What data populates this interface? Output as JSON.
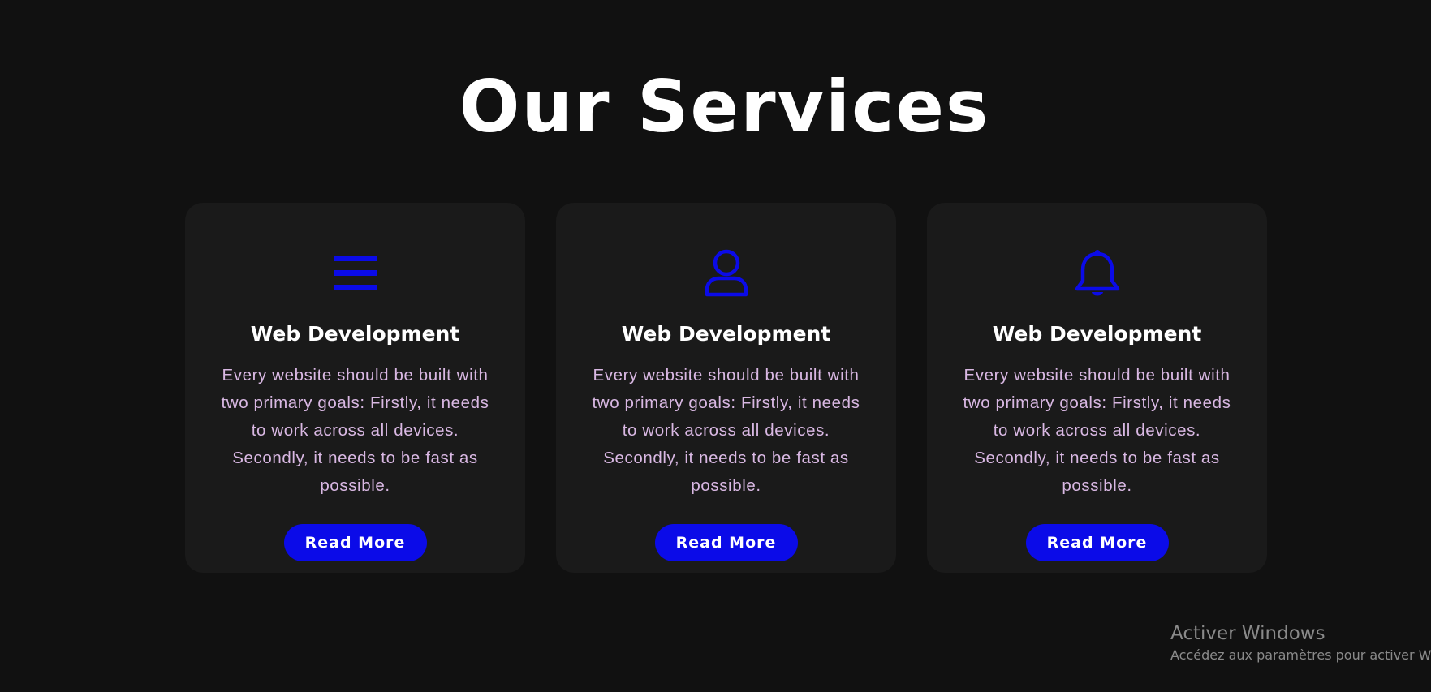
{
  "section": {
    "title": "Our Services"
  },
  "cards": [
    {
      "icon": "menu-bars-icon",
      "title": "Web Development",
      "text": "Every website should be built with two primary goals: Firstly, it needs to work across all devices. Secondly, it needs to be fast as possible.",
      "button_label": "Read More"
    },
    {
      "icon": "user-icon",
      "title": "Web Development",
      "text": "Every website should be built with two primary goals: Firstly, it needs to work across all devices. Secondly, it needs to be fast as possible.",
      "button_label": "Read More"
    },
    {
      "icon": "bell-icon",
      "title": "Web Development",
      "text": "Every website should be built with two primary goals: Firstly, it needs to work across all devices. Secondly, it needs to be fast as possible.",
      "button_label": "Read More"
    }
  ],
  "watermark": {
    "title": "Activer Windows",
    "subtitle": "Accédez aux paramètres pour activer Windows."
  },
  "colors": {
    "background": "#111111",
    "card": "#1a1a1a",
    "accent": "#0b0be8",
    "body_text": "#d9b8e3",
    "heading": "#ffffff"
  }
}
